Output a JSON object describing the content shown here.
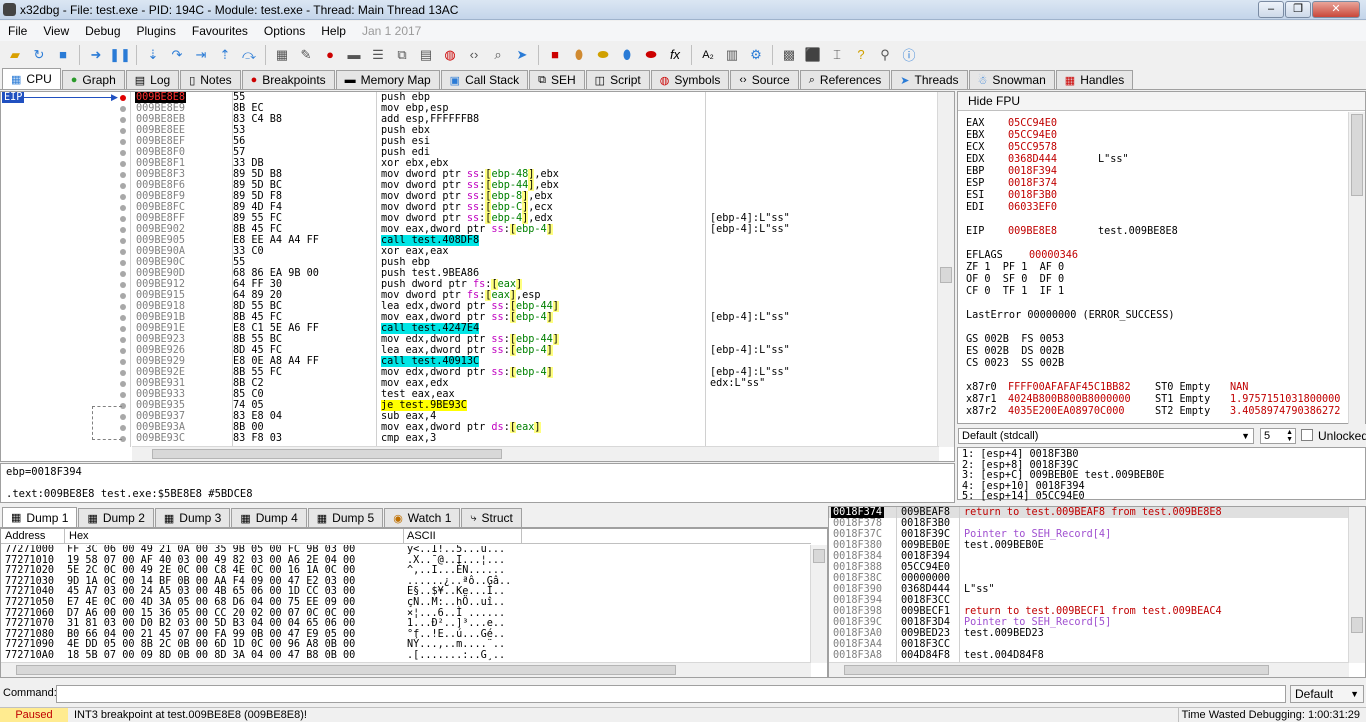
{
  "window": {
    "title": "x32dbg - File: test.exe - PID: 194C - Module: test.exe - Thread: Main Thread 13AC"
  },
  "menu": [
    "File",
    "View",
    "Debug",
    "Plugins",
    "Favourites",
    "Options",
    "Help",
    "Jan 1 2017"
  ],
  "tabs": [
    {
      "label": "CPU",
      "icon": "cpu-icon"
    },
    {
      "label": "Graph",
      "icon": "graph-icon"
    },
    {
      "label": "Log",
      "icon": "log-icon"
    },
    {
      "label": "Notes",
      "icon": "notes-icon"
    },
    {
      "label": "Breakpoints",
      "icon": "breakpoint-icon"
    },
    {
      "label": "Memory Map",
      "icon": "memory-map-icon"
    },
    {
      "label": "Call Stack",
      "icon": "call-stack-icon"
    },
    {
      "label": "SEH",
      "icon": "seh-icon"
    },
    {
      "label": "Script",
      "icon": "script-icon"
    },
    {
      "label": "Symbols",
      "icon": "symbols-icon"
    },
    {
      "label": "Source",
      "icon": "source-icon"
    },
    {
      "label": "References",
      "icon": "references-icon"
    },
    {
      "label": "Threads",
      "icon": "threads-icon"
    },
    {
      "label": "Snowman",
      "icon": "snowman-icon"
    },
    {
      "label": "Handles",
      "icon": "handles-icon"
    }
  ],
  "disasm": {
    "eip_label": "EIP",
    "rows": [
      {
        "addr": "009BE8E8",
        "bytes": "55",
        "ins": "push ebp",
        "cmt": ""
      },
      {
        "addr": "009BE8E9",
        "bytes": "8B EC",
        "ins": "mov ebp,esp",
        "cmt": ""
      },
      {
        "addr": "009BE8EB",
        "bytes": "83 C4 B8",
        "ins": "add esp,FFFFFFB8",
        "cmt": ""
      },
      {
        "addr": "009BE8EE",
        "bytes": "53",
        "ins": "push ebx",
        "cmt": ""
      },
      {
        "addr": "009BE8EF",
        "bytes": "56",
        "ins": "push esi",
        "cmt": ""
      },
      {
        "addr": "009BE8F0",
        "bytes": "57",
        "ins": "push edi",
        "cmt": ""
      },
      {
        "addr": "009BE8F1",
        "bytes": "33 DB",
        "ins": "xor ebx,ebx",
        "cmt": ""
      },
      {
        "addr": "009BE8F3",
        "bytes": "89 5D B8",
        "ins": "mov dword ptr ss:[ebp-48],ebx",
        "cmt": ""
      },
      {
        "addr": "009BE8F6",
        "bytes": "89 5D BC",
        "ins": "mov dword ptr ss:[ebp-44],ebx",
        "cmt": ""
      },
      {
        "addr": "009BE8F9",
        "bytes": "89 5D F8",
        "ins": "mov dword ptr ss:[ebp-8],ebx",
        "cmt": ""
      },
      {
        "addr": "009BE8FC",
        "bytes": "89 4D F4",
        "ins": "mov dword ptr ss:[ebp-C],ecx",
        "cmt": ""
      },
      {
        "addr": "009BE8FF",
        "bytes": "89 55 FC",
        "ins": "mov dword ptr ss:[ebp-4],edx",
        "cmt": "[ebp-4]:L\"ss\""
      },
      {
        "addr": "009BE902",
        "bytes": "8B 45 FC",
        "ins": "mov eax,dword ptr ss:[ebp-4]",
        "cmt": "[ebp-4]:L\"ss\""
      },
      {
        "addr": "009BE905",
        "bytes": "E8 EE A4 A4 FF",
        "ins": "call test.408DF8",
        "cmt": ""
      },
      {
        "addr": "009BE90A",
        "bytes": "33 C0",
        "ins": "xor eax,eax",
        "cmt": ""
      },
      {
        "addr": "009BE90C",
        "bytes": "55",
        "ins": "push ebp",
        "cmt": ""
      },
      {
        "addr": "009BE90D",
        "bytes": "68 86 EA 9B 00",
        "ins": "push test.9BEA86",
        "cmt": ""
      },
      {
        "addr": "009BE912",
        "bytes": "64 FF 30",
        "ins": "push dword ptr fs:[eax]",
        "cmt": ""
      },
      {
        "addr": "009BE915",
        "bytes": "64 89 20",
        "ins": "mov dword ptr fs:[eax],esp",
        "cmt": ""
      },
      {
        "addr": "009BE918",
        "bytes": "8D 55 BC",
        "ins": "lea edx,dword ptr ss:[ebp-44]",
        "cmt": ""
      },
      {
        "addr": "009BE91B",
        "bytes": "8B 45 FC",
        "ins": "mov eax,dword ptr ss:[ebp-4]",
        "cmt": "[ebp-4]:L\"ss\""
      },
      {
        "addr": "009BE91E",
        "bytes": "E8 C1 5E A6 FF",
        "ins": "call test.4247E4",
        "cmt": ""
      },
      {
        "addr": "009BE923",
        "bytes": "8B 55 BC",
        "ins": "mov edx,dword ptr ss:[ebp-44]",
        "cmt": ""
      },
      {
        "addr": "009BE926",
        "bytes": "8D 45 FC",
        "ins": "lea eax,dword ptr ss:[ebp-4]",
        "cmt": "[ebp-4]:L\"ss\""
      },
      {
        "addr": "009BE929",
        "bytes": "E8 0E A8 A4 FF",
        "ins": "call test.40913C",
        "cmt": ""
      },
      {
        "addr": "009BE92E",
        "bytes": "8B 55 FC",
        "ins": "mov edx,dword ptr ss:[ebp-4]",
        "cmt": "[ebp-4]:L\"ss\""
      },
      {
        "addr": "009BE931",
        "bytes": "8B C2",
        "ins": "mov eax,edx",
        "cmt": "edx:L\"ss\""
      },
      {
        "addr": "009BE933",
        "bytes": "85 C0",
        "ins": "test eax,eax",
        "cmt": ""
      },
      {
        "addr": "009BE935",
        "bytes": "74 05",
        "ins": "je test.9BE93C",
        "cmt": ""
      },
      {
        "addr": "009BE937",
        "bytes": "83 E8 04",
        "ins": "sub eax,4",
        "cmt": ""
      },
      {
        "addr": "009BE93A",
        "bytes": "8B 00",
        "ins": "mov eax,dword ptr ds:[eax]",
        "cmt": ""
      },
      {
        "addr": "009BE93C",
        "bytes": "83 F8 03",
        "ins": "cmp eax,3",
        "cmt": ""
      }
    ]
  },
  "registers": {
    "hide_fpu": "Hide FPU",
    "lines": [
      [
        "EAX",
        "05CC94E0",
        ""
      ],
      [
        "EBX",
        "05CC94E0",
        ""
      ],
      [
        "ECX",
        "05CC9578",
        ""
      ],
      [
        "EDX",
        "0368D444",
        "L\"ss\""
      ],
      [
        "EBP",
        "0018F394",
        ""
      ],
      [
        "ESP",
        "0018F374",
        ""
      ],
      [
        "ESI",
        "0018F3B0",
        ""
      ],
      [
        "EDI",
        "06033EF0",
        ""
      ]
    ],
    "eip": [
      "EIP",
      "009BE8E8",
      "test.009BE8E8"
    ],
    "eflags": [
      "EFLAGS",
      "00000346"
    ],
    "flags": [
      "ZF 1  PF 1  AF 0",
      "OF 0  SF 0  DF 0",
      "CF 0  TF 1  IF 1"
    ],
    "lasterror": "LastError 00000000 (ERROR_SUCCESS)",
    "segs": [
      "GS 002B  FS 0053",
      "ES 002B  DS 002B",
      "CS 0023  SS 002B"
    ],
    "fpu": [
      [
        "x87r0",
        "FFFF00AFAFAF45C1BB82",
        "ST0 Empty",
        "NAN"
      ],
      [
        "x87r1",
        "4024B800B800B8000000",
        "ST1 Empty",
        "1.9757151031800000"
      ],
      [
        "x87r2",
        "4035E200EA08970C000",
        "ST2 Empty",
        "3.4058974790386272"
      ]
    ]
  },
  "callconv": {
    "value": "Default (stdcall)",
    "count": "5",
    "unlocked": "Unlocked"
  },
  "args": [
    "1: [esp+4] 0018F3B0",
    "2: [esp+8] 0018F39C",
    "3: [esp+C] 009BEB0E test.009BEB0E",
    "4: [esp+10] 0018F394",
    "5: [esp+14] 05CC94E0"
  ],
  "info": {
    "line1": "ebp=0018F394",
    "line2": ".text:009BE8E8 test.exe:$5BE8E8 #5BDCE8"
  },
  "dump_tabs": [
    "Dump 1",
    "Dump 2",
    "Dump 3",
    "Dump 4",
    "Dump 5",
    "Watch 1",
    "Struct"
  ],
  "dump": {
    "headers": [
      "Address",
      "Hex",
      "ASCII"
    ],
    "rows": [
      [
        "77271000",
        "FF 3C 06 00 49 21 0A 00 35 9B 05 00 FC 9B 03 00",
        "ÿ<..I!..5...ü..."
      ],
      [
        "77271010",
        "19 58 07 00 AF 40 03 00 49 82 03 00 A6 2E 04 00",
        ".X..¯@..I...¦..."
      ],
      [
        "77271020",
        "5E 2C 0C 00 49 2E 0C 00 C8 4E 0C 00 16 1A 0C 00",
        "^,..I...ÈN......"
      ],
      [
        "77271030",
        "9D 1A 0C 00 14 BF 0B 00 AA F4 09 00 47 E2 03 00",
        "......¿..ªô..Gâ.."
      ],
      [
        "77271040",
        "45 A7 03 00 24 A5 03 00 4B 65 06 00 1D CC 03 00",
        "E§..$¥..Ke...Ì.."
      ],
      [
        "77271050",
        "E7 4E 0C 00 4D 3A 05 00 68 D6 04 00 75 EE 09 00",
        "çN..M:..hÖ..uî.."
      ],
      [
        "77271060",
        "D7 A6 00 00 15 36 05 00 CC 20 02 00 07 0C 0C 00",
        "×¦...6..Ì ......"
      ],
      [
        "77271070",
        "31 81 03 00 D0 B2 03 00 5D B3 04 00 04 65 06 00",
        "1...Ð²..]³...e.."
      ],
      [
        "77271080",
        "B0 66 04 00 21 45 07 00 FA 99 0B 00 47 E9 05 00",
        "°f..!E..ú...Gé.."
      ],
      [
        "77271090",
        "4E DD 05 00 8B 2C 0B 00 6D 1D 0C 00 96 A8 0B 00",
        "NÝ...,..m....¨.."
      ],
      [
        "772710A0",
        "18 5B 07 00 09 8D 0B 00 8D 3A 04 00 47 B8 0B 00",
        ".[.......:..G¸.."
      ]
    ]
  },
  "stack": {
    "rows": [
      [
        "0018F374",
        "009BEAF8",
        "return to test.009BEAF8 from test.009BE8E8",
        "red"
      ],
      [
        "0018F378",
        "0018F3B0",
        "",
        ""
      ],
      [
        "0018F37C",
        "0018F39C",
        "Pointer to SEH_Record[4]",
        "mem"
      ],
      [
        "0018F380",
        "009BEB0E",
        "test.009BEB0E",
        ""
      ],
      [
        "0018F384",
        "0018F394",
        "",
        ""
      ],
      [
        "0018F388",
        "05CC94E0",
        "",
        ""
      ],
      [
        "0018F38C",
        "00000000",
        "",
        ""
      ],
      [
        "0018F390",
        "0368D444",
        "L\"ss\"",
        ""
      ],
      [
        "0018F394",
        "0018F3CC",
        "",
        ""
      ],
      [
        "0018F398",
        "009BECF1",
        "return to test.009BECF1 from test.009BEAC4",
        "red"
      ],
      [
        "0018F39C",
        "0018F3D4",
        "Pointer to SEH_Record[5]",
        "mem"
      ],
      [
        "0018F3A0",
        "009BED23",
        "test.009BED23",
        ""
      ],
      [
        "0018F3A4",
        "0018F3CC",
        "",
        ""
      ],
      [
        "0018F3A8",
        "004D84F8",
        "test.004D84F8",
        ""
      ]
    ]
  },
  "command": {
    "label": "Command:",
    "value": "",
    "mode": "Default"
  },
  "status": {
    "state": "Paused",
    "message": "INT3 breakpoint at test.009BE8E8 (009BE8E8)!",
    "time": "Time Wasted Debugging: 1:00:31:29"
  }
}
